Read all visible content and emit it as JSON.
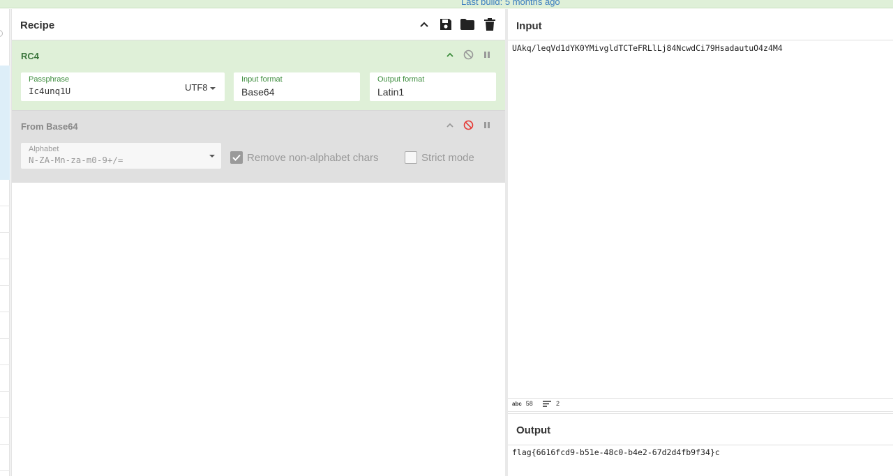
{
  "banner": {
    "build_text": "Last build: 5 months ago"
  },
  "recipe": {
    "title": "Recipe",
    "operations": [
      {
        "name": "RC4",
        "passphrase": {
          "label": "Passphrase",
          "value": "Ic4unq1U",
          "encoding": "UTF8"
        },
        "input_format": {
          "label": "Input format",
          "value": "Base64"
        },
        "output_format": {
          "label": "Output format",
          "value": "Latin1"
        },
        "state": "enabled"
      },
      {
        "name": "From Base64",
        "alphabet": {
          "label": "Alphabet",
          "value": "N-ZA-Mn-za-m0-9+/="
        },
        "remove_non_alphabet": {
          "label": "Remove non-alphabet chars",
          "checked": true
        },
        "strict_mode": {
          "label": "Strict mode",
          "checked": false
        },
        "state": "disabled"
      }
    ]
  },
  "input": {
    "title": "Input",
    "text": "UAkq/leqVd1dYK0YMivgldTCTeFRLlLj84NcwdCi79HsadautuO4z4M4",
    "status": {
      "length_icon": "abc",
      "length": "58",
      "lines_icon": "lines-icon",
      "lines": "2"
    }
  },
  "output": {
    "title": "Output",
    "text": "flag{6616fcd9-b51e-48c0-b4e2-67d2d4fb9f34}c"
  },
  "colors": {
    "rc4_bg": "#dff0d8",
    "disabled_bg": "#e0e0e0",
    "disable_active": "#e53935",
    "accent_green": "#3c763d"
  }
}
